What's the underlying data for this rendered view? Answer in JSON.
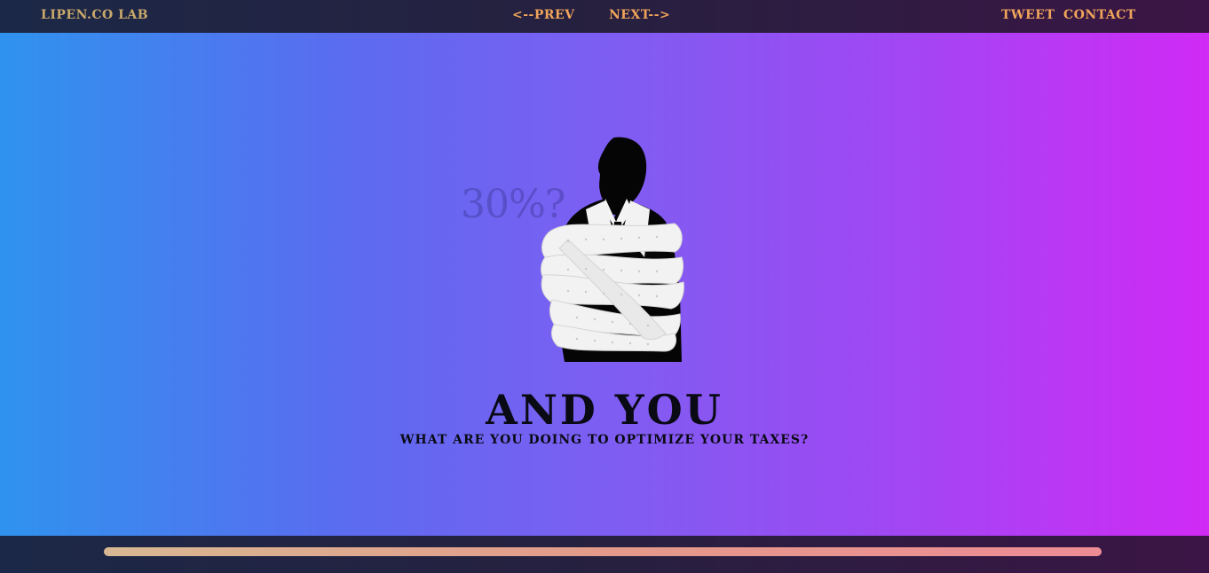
{
  "nav": {
    "brand": "LIPEN.CO LAB",
    "prev": "<--PREV",
    "next": "NEXT-->",
    "tweet": "TWEET",
    "contact": "CONTACT"
  },
  "slide": {
    "background_stat": "30%?",
    "title": "AND YOU",
    "subtitle": "WHAT ARE YOU DOING TO OPTIMIZE YOUR TAXES?"
  },
  "progress": {
    "fraction": 1.0
  },
  "colors": {
    "nav_accent": "#f0a55a",
    "brand": "#c9a96a",
    "gradient_start": "#2f93ee",
    "gradient_end": "#d02af5"
  }
}
